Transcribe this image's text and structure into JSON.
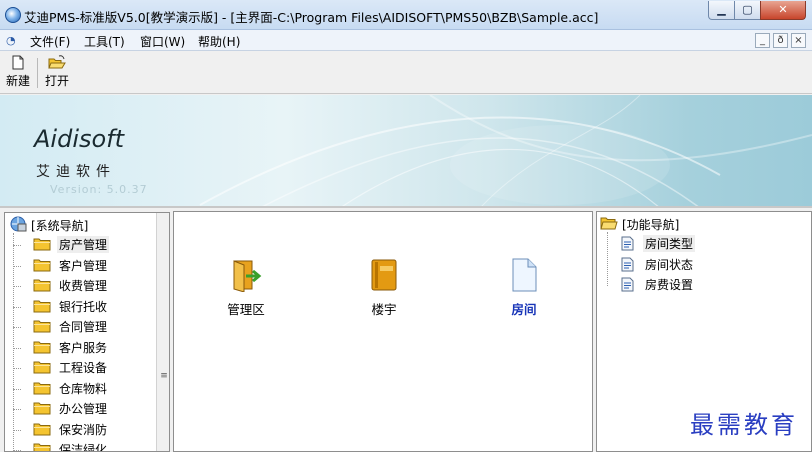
{
  "window": {
    "title": "艾迪PMS-标准版V5.0[教学演示版] - [主界面-C:\\Program Files\\AIDISOFT\\PMS50\\BZB\\Sample.acc]",
    "min_icon": "minimize-icon",
    "max_icon": "maximize-icon",
    "close_icon": "close-icon"
  },
  "menu": {
    "items": [
      "文件(F)",
      "工具(T)",
      "窗口(W)",
      "帮助(H)"
    ],
    "mdi_buttons": [
      "_",
      "ð",
      "×"
    ]
  },
  "toolbar": {
    "new_label": "新建",
    "open_label": "打开"
  },
  "banner": {
    "brand": "Aidisoft",
    "brand_cn": "艾迪软件",
    "version": "Version: 5.0.37"
  },
  "left_nav": {
    "root_label": "[系统导航]",
    "items": [
      "房产管理",
      "客户管理",
      "收费管理",
      "银行托收",
      "合同管理",
      "客户服务",
      "工程设备",
      "仓库物料",
      "办公管理",
      "保安消防",
      "保洁绿化"
    ],
    "selected": "房产管理"
  },
  "main_items": {
    "items": [
      "管理区",
      "楼宇",
      "房间"
    ],
    "active": "房间"
  },
  "func_nav": {
    "root_label": "[功能导航]",
    "items": [
      "房间类型",
      "房间状态",
      "房费设置"
    ],
    "selected": "房间类型"
  },
  "watermark": "最需教育",
  "colors": {
    "accent": "#1835b8",
    "folder": "#f4c430",
    "banner": "#a5d0dc"
  }
}
